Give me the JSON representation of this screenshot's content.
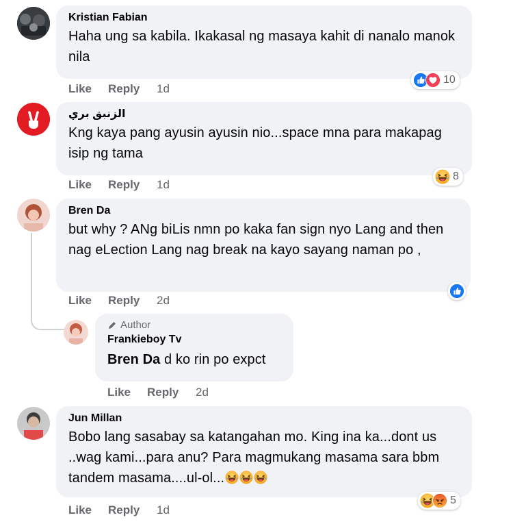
{
  "comments": [
    {
      "name": "Kristian Fabian",
      "text": "Haha ung sa kabila. Ikakasal ng masaya kahit di nanalo manok nila",
      "like": "Like",
      "reply": "Reply",
      "time": "1d",
      "reactions": [
        "like",
        "love"
      ],
      "reaction_count": "10"
    },
    {
      "name": "الزنبق بري",
      "text": "Kng kaya pang ayusin ayusin nio...space mna para makapag isip ng tama",
      "like": "Like",
      "reply": "Reply",
      "time": "1d",
      "reactions": [
        "haha"
      ],
      "reaction_count": "8"
    },
    {
      "name": "Bren Da",
      "text": "but why ? ANg biLis nmn po kaka fan sign nyo Lang and then nag eLection Lang nag break na kayo sayang naman po ,",
      "like": "Like",
      "reply": "Reply",
      "time": "2d",
      "reactions": [
        "like"
      ]
    },
    {
      "name": "Jun Millan",
      "text": "Bobo lang sasabay sa katangahan mo. King ina ka...dont us ..wag kami...para anu? Para magmukang masama sara bbm tandem masama....ul-ol...",
      "like": "Like",
      "reply": "Reply",
      "time": "1d",
      "reactions": [
        "haha",
        "angry"
      ],
      "reaction_count": "5"
    }
  ],
  "reply": {
    "author_label": "Author",
    "name": "Frankieboy Tv",
    "mention": "Bren Da",
    "text": " d ko rin po expct",
    "like": "Like",
    "reply": "Reply",
    "time": "2d"
  },
  "colors": {
    "bubble": "#f0f2f5",
    "meta_text": "#65676b",
    "like_blue": "#1877f2",
    "love_red": "#f33e58",
    "haha_yellow": "#f7b125"
  },
  "icons": [
    "like-reaction-icon",
    "love-reaction-icon",
    "haha-reaction-icon",
    "angry-reaction-icon",
    "pencil-icon"
  ]
}
